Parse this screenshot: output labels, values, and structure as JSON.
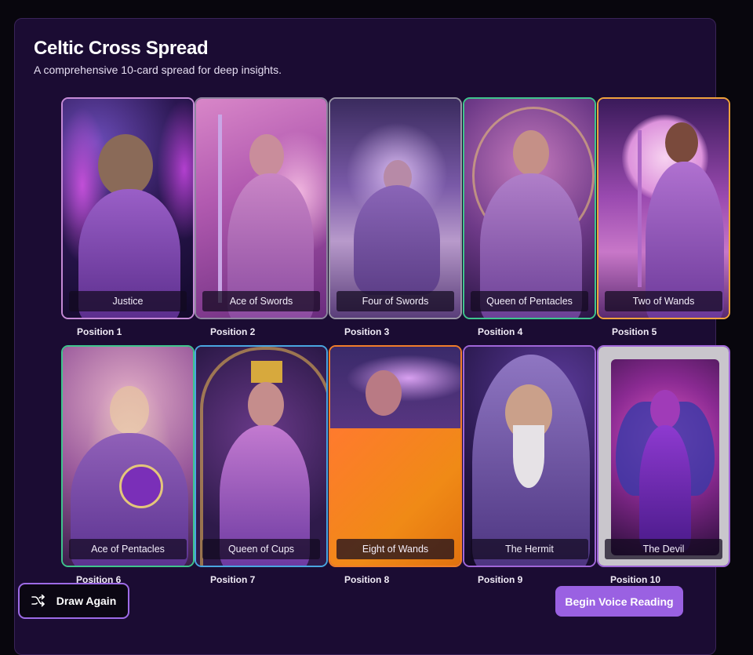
{
  "header": {
    "title": "Celtic Cross Spread",
    "subtitle": "A comprehensive 10-card spread for deep insights."
  },
  "cards": [
    {
      "name": "Justice",
      "position": "Position 1",
      "border": "#c58ad6"
    },
    {
      "name": "Ace of Swords",
      "position": "Position 2",
      "border": "#8f86a0"
    },
    {
      "name": "Four of Swords",
      "position": "Position 3",
      "border": "#9a96a6"
    },
    {
      "name": "Queen of Pentacles",
      "position": "Position 4",
      "border": "#3fc48d"
    },
    {
      "name": "Two of Wands",
      "position": "Position 5",
      "border": "#f0a23c"
    },
    {
      "name": "Ace of Pentacles",
      "position": "Position 6",
      "border": "#3fc48d"
    },
    {
      "name": "Queen of Cups",
      "position": "Position 7",
      "border": "#49a6e0"
    },
    {
      "name": "Eight of Wands",
      "position": "Position 8",
      "border": "#f07d2a"
    },
    {
      "name": "The Hermit",
      "position": "Position 9",
      "border": "#a066d8"
    },
    {
      "name": "The Devil",
      "position": "Position 10",
      "border": "#a066d8"
    }
  ],
  "actions": {
    "draw_again": "Draw Again",
    "draw_again_icon": "shuffle-icon",
    "voice_reading": "Begin Voice Reading"
  },
  "colors": {
    "background": "#08060d",
    "panel": "#1b0c33",
    "accent": "#9a61e2"
  }
}
